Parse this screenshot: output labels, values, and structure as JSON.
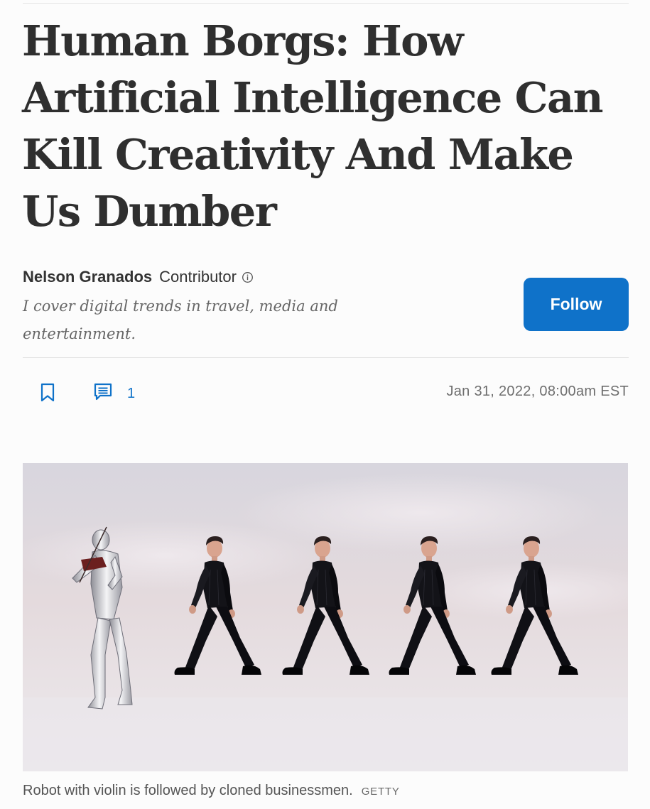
{
  "article": {
    "headline": "Human Borgs: How Artificial Intelligence Can Kill Creativity And Make Us Dumber",
    "author": {
      "name": "Nelson Granados",
      "role": "Contributor",
      "bio": "I cover digital trends in travel, media and entertainment."
    },
    "follow_label": "Follow",
    "comment_count": "1",
    "published": "Jan 31, 2022, 08:00am EST",
    "image": {
      "caption": "Robot with violin is followed by cloned businessmen.",
      "credit": "GETTY"
    }
  },
  "icons": {
    "info": "info-circle-icon",
    "bookmark": "bookmark-icon",
    "comments": "comment-icon"
  },
  "colors": {
    "accent": "#0f72c9",
    "headline": "#2f2f2f",
    "muted": "#6e6e6e"
  }
}
